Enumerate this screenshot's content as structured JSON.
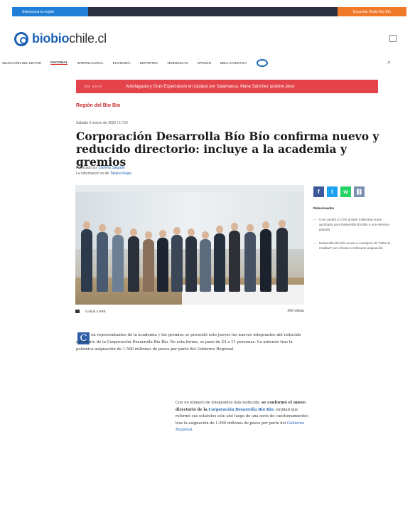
{
  "topbar": {
    "region_select": "Selecciona tu región",
    "radio_button": "Escuchar Radio Bío Bío"
  },
  "logo": {
    "part1": "biobio",
    "part2": "chile.cl"
  },
  "nav": {
    "items": [
      "SELECCIÓN DEL EDITOR",
      "NACIONAL",
      "INTERNACIONAL",
      "ECONOMÍA",
      "DEPORTES",
      "TENDENCIAS",
      "OPINIÓN",
      "BBCL INVESTIGA"
    ],
    "active": "NACIONAL"
  },
  "breaking": {
    "label": "EN VIVO",
    "headline": "Antofagasta y Gran Espectáculo en Iquique por Salamanca. Mane Sánchez quiebre peso"
  },
  "article": {
    "section": "Región del Bío Bío",
    "date": "Sábado 5 marzo de 2022 | 17:50",
    "title": "Corporación Desarrolla Bío Bío confirma nuevo y reducido directorio: incluye a la academia y gremios",
    "byline_prefix": "Publicado por",
    "author": "Daniela Salgado",
    "info_prefix": "La información es de",
    "source": "Tatiana Rojas",
    "photo_caption": "Cedida a RBB",
    "views": "266 visitas",
    "dropcap": "C",
    "lead": "on representantes de la academia y los gremios se presentó este jueves los nuevos integrantes del reducido directorio de la Corporación Desarrolla Bío Bío. De esta forma, se pasó de 23 a 11 personas. Lo anterior tras la polémica asignación de 1.500 millones de pesos por parte del Gobierno Regional.",
    "p2_a": "Con un número de integrantes más reducido, ",
    "p2_bold": "se conformó el nuevo directorio de la ",
    "p2_link": "Corporación Desarrolla Bío Bío",
    "p2_b": ", entidad que reformó sus estatutos este año luego de una serie de cuestionamientos tras la asignación de 1.500 millones de pesos por parte del ",
    "p2_link2": "Gobierno Regional",
    "p2_end": "."
  },
  "related": {
    "title": "Relacionados",
    "items": [
      "Core pedirá a CGR aclarar millonaria suma aprobada para Desarrolla Bío Bío a una semana pasada",
      "Desarrolla Bío Bío acusa a consejero de \"faltar la realidad\" por críticas a millonaria asignación"
    ]
  },
  "colors": {
    "brand_blue": "#1e63b3",
    "breaking_red": "#e5434a",
    "section_red": "#c62828",
    "radio_orange": "#f1792a"
  }
}
